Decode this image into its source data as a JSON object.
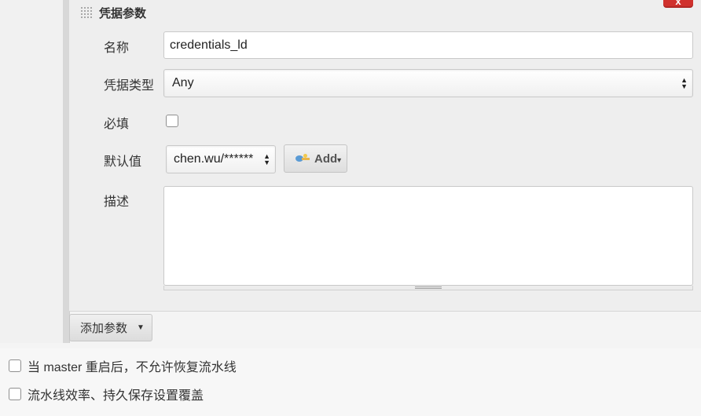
{
  "param_block": {
    "title": "凭据参数",
    "close_label": "x",
    "fields": {
      "name": {
        "label": "名称",
        "value": "credentials_ld"
      },
      "credential_type": {
        "label": "凭据类型",
        "selected": "Any"
      },
      "required": {
        "label": "必填",
        "checked": false
      },
      "default_value": {
        "label": "默认值",
        "selected": "chen.wu/******",
        "add_label": "Add"
      },
      "description": {
        "label": "描述",
        "value": ""
      }
    },
    "icons": {
      "grip": "drag-grip-icon",
      "key": "credentials-key-icon"
    }
  },
  "toolbar": {
    "add_param_label": "添加参数"
  },
  "options": [
    {
      "label": "当 master 重启后，不允许恢复流水线",
      "checked": false
    },
    {
      "label": "流水线效率、持久保存设置覆盖",
      "checked": false
    }
  ],
  "colors": {
    "close_button": "#d0312d",
    "panel_bg": "#eeeeee"
  }
}
